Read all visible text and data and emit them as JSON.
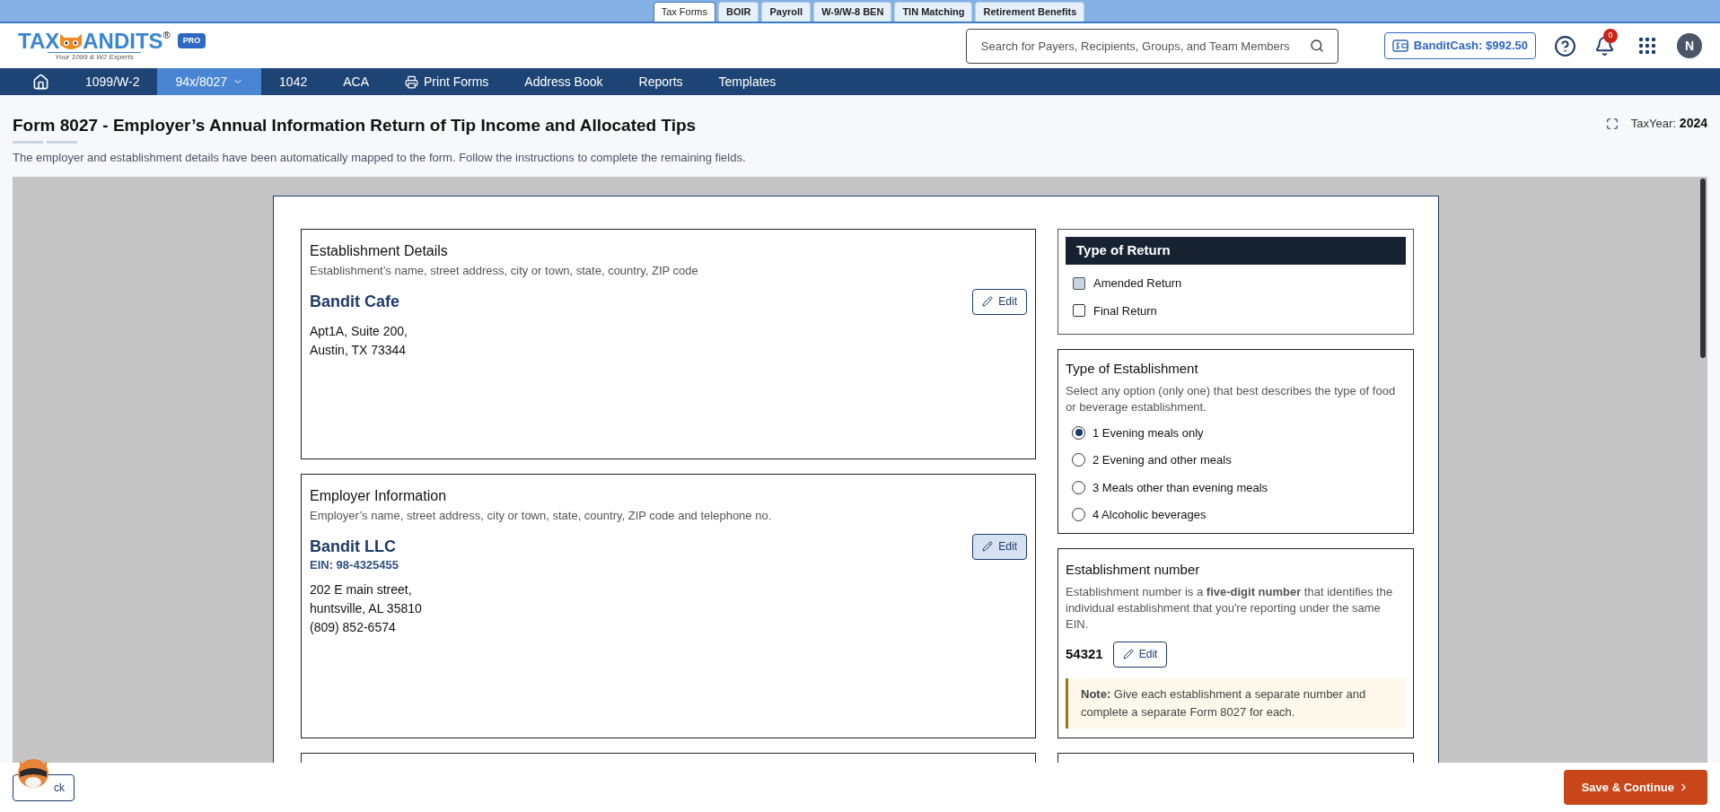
{
  "top_tabs": [
    {
      "label": "Tax Forms",
      "selected": true
    },
    {
      "label": "BOIR",
      "selected": false
    },
    {
      "label": "Payroll",
      "selected": false
    },
    {
      "label": "W-9/W-8 BEN",
      "selected": false
    },
    {
      "label": "TIN Matching",
      "selected": false
    },
    {
      "label": "Retirement Benefits",
      "selected": false
    }
  ],
  "header": {
    "logo": {
      "left": "TAX",
      "right": "ANDITS",
      "mark": "®",
      "tagline": "Your 1099 & W2 Experts",
      "badge": "PRO"
    },
    "search": {
      "placeholder": "Search for Payers, Recipients, Groups, and Team Members"
    },
    "bandit_cash": "BanditCash: $992.50",
    "notifications": "0",
    "avatar": "N"
  },
  "nav": {
    "items": [
      {
        "kind": "home",
        "selected": false
      },
      {
        "kind": "link",
        "label": "1099/W-2",
        "selected": false
      },
      {
        "kind": "menu",
        "label": "94x/8027",
        "selected": true
      },
      {
        "kind": "link",
        "label": "1042",
        "selected": false
      },
      {
        "kind": "link",
        "label": "ACA",
        "selected": false
      },
      {
        "kind": "print",
        "label": "Print Forms",
        "selected": false
      },
      {
        "kind": "link",
        "label": "Address Book",
        "selected": false
      },
      {
        "kind": "link",
        "label": "Reports",
        "selected": false
      },
      {
        "kind": "link",
        "label": "Templates",
        "selected": false
      }
    ]
  },
  "page": {
    "title": "Form 8027 - Employer’s Annual Information Return of Tip Income and Allocated Tips",
    "subtitle": "The employer and establishment details have been automatically mapped to the form. Follow the instructions to complete the remaining fields.",
    "tax_year_label": "TaxYear:",
    "tax_year": "2024"
  },
  "establishment_details": {
    "heading": "Establishment Details",
    "hint": "Establishment’s name, street address, city or town, state, country, ZIP code",
    "name": "Bandit Cafe",
    "address_lines": [
      "Apt1A, Suite 200,",
      "Austin, TX 73344"
    ],
    "edit": {
      "label": "Edit",
      "highlighted": false
    }
  },
  "employer_information": {
    "heading": "Employer Information",
    "hint": "Employer’s name, street address, city or town, state, country, ZIP code and telephone no.",
    "name": "Bandit LLC",
    "ein": "EIN: 98-4325455",
    "address_lines": [
      "202 E main street,",
      "huntsville, AL 35810",
      "(809) 852-6574"
    ],
    "edit": {
      "label": "Edit",
      "highlighted": true
    }
  },
  "type_of_return": {
    "heading": "Type of Return",
    "options": [
      {
        "label": "Amended Return",
        "checked": false,
        "highlighted": true
      },
      {
        "label": "Final Return",
        "checked": false,
        "highlighted": false
      }
    ]
  },
  "type_of_establishment": {
    "heading": "Type of Establishment",
    "hint": "Select any option (only one) that best describes the type of food or beverage establishment.",
    "options": [
      {
        "label": "1 Evening meals only",
        "selected": true
      },
      {
        "label": "2 Evening and other meals",
        "selected": false
      },
      {
        "label": "3 Meals other than evening meals",
        "selected": false
      },
      {
        "label": "4 Alcoholic beverages",
        "selected": false
      }
    ]
  },
  "establishment_number": {
    "heading": "Establishment number",
    "hint": "Establishment number is a **five-digit number** that identifies the individual establishment that you're reporting under the same EIN.",
    "value": "54321",
    "edit": {
      "label": "Edit",
      "highlighted": false
    },
    "note": "**Note:** Give each establishment a separate number and complete a separate Form 8027 for each."
  },
  "footer": {
    "back": "ck",
    "save": "Save & Continue"
  }
}
